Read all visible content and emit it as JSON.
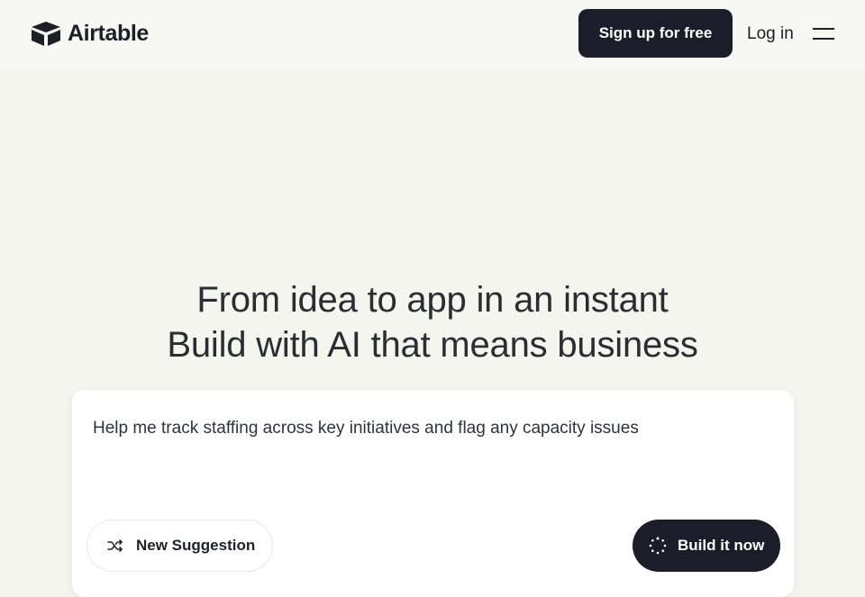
{
  "header": {
    "logo_text": "Airtable",
    "signup_label": "Sign up for free",
    "login_label": "Log in",
    "menu_icon": "hamburger-menu-icon"
  },
  "hero": {
    "line1": "From idea to app in an instant",
    "line2": "Build with AI that means business"
  },
  "prompt": {
    "text": "Help me track staffing across key initiatives and flag any capacity issues",
    "suggestion_label": "New Suggestion",
    "suggestion_icon": "shuffle-icon",
    "build_label": "Build it now",
    "build_icon": "loading-spinner-icon"
  },
  "colors": {
    "background": "#f5f5f0",
    "primary_button": "#1b1e29",
    "text": "#1f2228"
  }
}
